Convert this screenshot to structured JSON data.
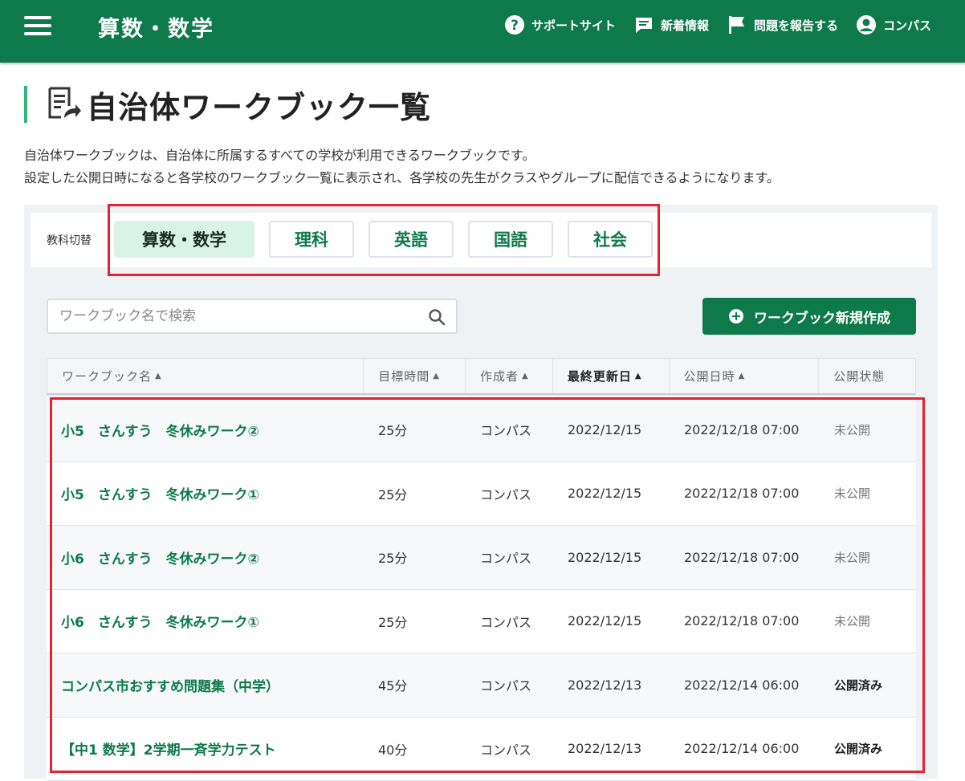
{
  "header": {
    "app_title": "算数・数学",
    "nav": [
      {
        "label": "サポートサイト",
        "icon": "help-circle-icon"
      },
      {
        "label": "新着情報",
        "icon": "message-icon"
      },
      {
        "label": "問題を報告する",
        "icon": "flag-icon"
      },
      {
        "label": "コンパス",
        "icon": "account-icon"
      }
    ]
  },
  "page": {
    "title": "自治体ワークブック一覧",
    "desc_line1": "自治体ワークブックは、自治体に所属するすべての学校が利用できるワークブックです。",
    "desc_line2": "設定した公開日時になると各学校のワークブック一覧に表示され、各学校の先生がクラスやグループに配信できるようになります。"
  },
  "subject": {
    "label": "教科切替",
    "options": [
      "算数・数学",
      "理科",
      "英語",
      "国語",
      "社会"
    ],
    "selected": "算数・数学"
  },
  "search": {
    "placeholder": "ワークブック名で検索"
  },
  "new_button": {
    "label": "ワークブック新規作成"
  },
  "table": {
    "headers": [
      "ワークブック名",
      "目標時間",
      "作成者",
      "最終更新日",
      "公開日時",
      "公開状態"
    ],
    "sorted_column": "最終更新日",
    "rows": [
      {
        "name": "小5　さんすう　冬休みワーク②",
        "time": "25分",
        "author": "コンパス",
        "updated": "2022/12/15",
        "publish": "2022/12/18 07:00",
        "status": "未公開"
      },
      {
        "name": "小5　さんすう　冬休みワーク①",
        "time": "25分",
        "author": "コンパス",
        "updated": "2022/12/15",
        "publish": "2022/12/18 07:00",
        "status": "未公開"
      },
      {
        "name": "小6　さんすう　冬休みワーク②",
        "time": "25分",
        "author": "コンパス",
        "updated": "2022/12/15",
        "publish": "2022/12/18 07:00",
        "status": "未公開"
      },
      {
        "name": "小6　さんすう　冬休みワーク①",
        "time": "25分",
        "author": "コンパス",
        "updated": "2022/12/15",
        "publish": "2022/12/18 07:00",
        "status": "未公開"
      },
      {
        "name": "コンパス市おすすめ問題集（中学）",
        "time": "45分",
        "author": "コンパス",
        "updated": "2022/12/13",
        "publish": "2022/12/14 06:00",
        "status": "公開済み"
      },
      {
        "name": "【中1 数学】2学期一斉学力テスト",
        "time": "40分",
        "author": "コンパス",
        "updated": "2022/12/13",
        "publish": "2022/12/14 06:00",
        "status": "公開済み"
      }
    ]
  },
  "colors": {
    "brand": "#0e7a4c",
    "accent": "#2fb57a",
    "highlight": "#e32232"
  }
}
